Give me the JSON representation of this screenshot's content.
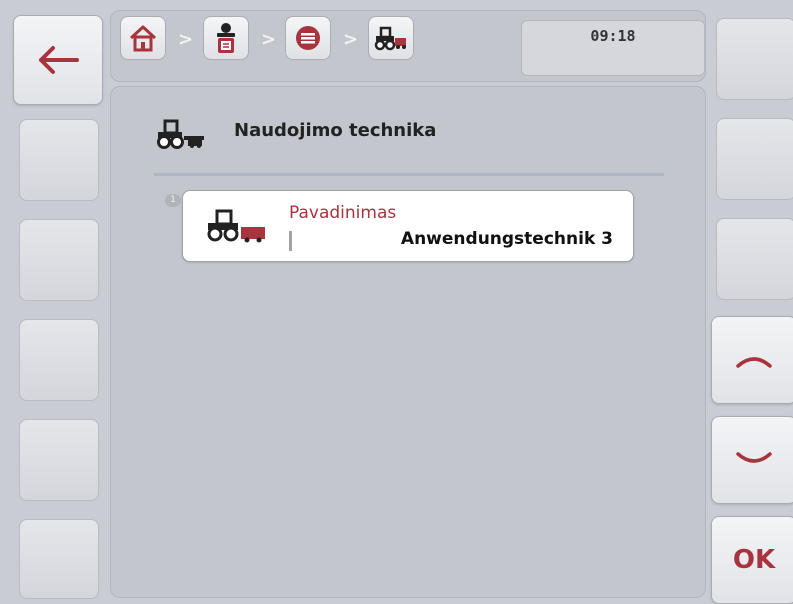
{
  "header": {
    "time": "09:18",
    "breadcrumb": [
      {
        "icon": "home-icon"
      },
      {
        "icon": "operator-icon"
      },
      {
        "icon": "list-icon"
      },
      {
        "icon": "tractor-machinery-icon"
      }
    ],
    "separator": ">"
  },
  "page": {
    "title": "Naudojimo technika",
    "title_icon": "tractor-machinery-icon"
  },
  "list": {
    "items": [
      {
        "index": "1",
        "icon": "tractor-machinery-icon",
        "label": "Pavadinimas",
        "value": "Anwendungstechnik 3"
      }
    ]
  },
  "softkeys": {
    "left": [
      {
        "icon": "back-arrow-icon"
      },
      {
        "icon": ""
      },
      {
        "icon": ""
      },
      {
        "icon": ""
      },
      {
        "icon": ""
      },
      {
        "icon": ""
      }
    ],
    "right": [
      {
        "icon": ""
      },
      {
        "icon": ""
      },
      {
        "icon": ""
      },
      {
        "icon": "scroll-up-icon"
      },
      {
        "icon": "scroll-down-icon"
      },
      {
        "label": "OK"
      }
    ]
  },
  "colors": {
    "accent": "#a8343d",
    "background": "#c9ccd3"
  }
}
